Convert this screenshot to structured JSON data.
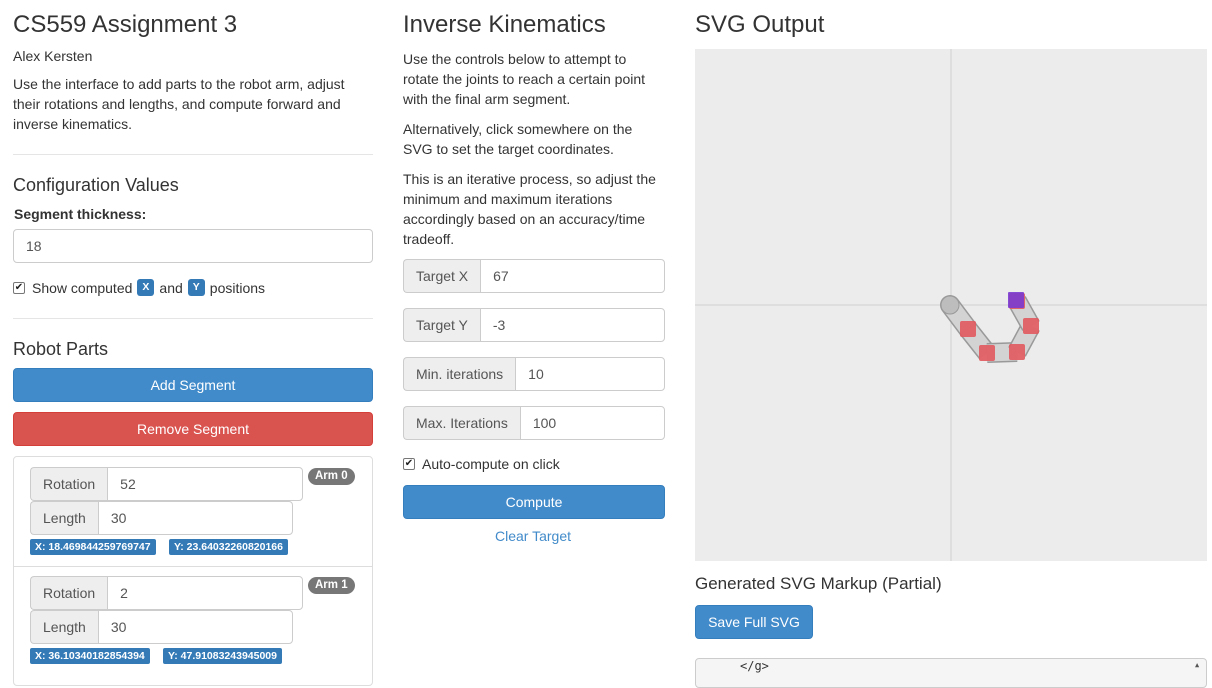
{
  "left": {
    "title": "CS559 Assignment 3",
    "author": "Alex Kersten",
    "intro": "Use the interface to add parts to the robot arm, adjust their rotations and lengths, and compute forward and inverse kinematics.",
    "config_heading": "Configuration Values",
    "thickness_label": "Segment thickness:",
    "thickness_value": "18",
    "show_checkbox": {
      "checked": true,
      "text_before": "Show computed",
      "x_tag": "X",
      "and": "and",
      "y_tag": "Y",
      "text_after": "positions"
    },
    "parts_heading": "Robot Parts",
    "add_segment": "Add Segment",
    "remove_segment": "Remove Segment",
    "arms": [
      {
        "badge": "Arm 0",
        "rotation_label": "Rotation",
        "rotation": "52",
        "length_label": "Length",
        "length": "30",
        "x_text": "X: 18.469844259769747",
        "y_text": "Y: 23.64032260820166"
      },
      {
        "badge": "Arm 1",
        "rotation_label": "Rotation",
        "rotation": "2",
        "length_label": "Length",
        "length": "30",
        "x_text": "X: 36.10340182854394",
        "y_text": "Y: 47.91083243945009"
      }
    ]
  },
  "mid": {
    "title": "Inverse Kinematics",
    "p1": "Use the controls below to attempt to rotate the joints to reach a certain point with the final arm segment.",
    "p2": "Alternatively, click somewhere on the SVG to set the target coordinates.",
    "p3": "This is an iterative process, so adjust the minimum and maximum iterations accordingly based on an accuracy/time tradeoff.",
    "target_x_label": "Target X",
    "target_x": "67",
    "target_y_label": "Target Y",
    "target_y": "-3",
    "min_iter_label": "Min. iterations",
    "min_iter": "10",
    "max_iter_label": "Max. Iterations",
    "max_iter": "100",
    "auto_compute": {
      "checked": true,
      "label": "Auto-compute on click"
    },
    "compute": "Compute",
    "clear_target": "Clear Target"
  },
  "right": {
    "title": "SVG Output",
    "generated_heading": "Generated SVG Markup (Partial)",
    "save_button": "Save Full SVG",
    "code_line": "</g>",
    "colors": {
      "canvas_bg": "#ececec",
      "axis": "#cfcfcf",
      "segment_fill": "#d3d3d3",
      "segment_stroke": "#999999",
      "joint": "#e0595e",
      "target": "#7b3bd1",
      "base": "#bdbdbd"
    }
  }
}
